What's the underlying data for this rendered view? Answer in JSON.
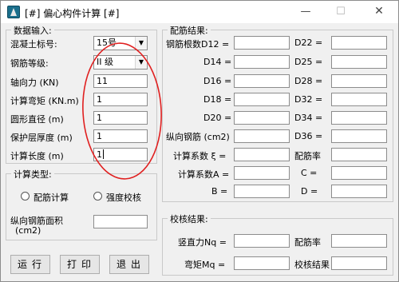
{
  "window": {
    "title": "[#] 偏心构件计算 [#]",
    "minimize": "—",
    "maximize": "☐",
    "close": "✕"
  },
  "input_group": {
    "title": "数据输入:",
    "concrete_label": "混凝土标号:",
    "concrete_value": "15号",
    "rebar_grade_label": "钢筋等级:",
    "rebar_grade_value": "II 级",
    "axial_force_label": "轴向力 (KN)",
    "axial_force_value": "11",
    "moment_label": "计算弯矩 (KN.m)",
    "moment_value": "1",
    "diameter_label": "圆形直径 (m)",
    "diameter_value": "1",
    "cover_label": "保护层厚度 (m)",
    "cover_value": "1",
    "length_label": "计算长度 (m)",
    "length_value": "1"
  },
  "calc_type_group": {
    "title": "计算类型:",
    "option_rebar": "配筋计算",
    "option_strength": "强度校核",
    "steel_area_label_1": "纵向钢筋面积",
    "steel_area_label_2": "(cm2)",
    "steel_area_value": ""
  },
  "buttons": {
    "run": "运行",
    "print": "打印",
    "exit": "退出"
  },
  "result_group": {
    "title": "配筋结果:",
    "bar_count_label": "钢筋根数D12 =",
    "d14": "D14 =",
    "d16": "D16 =",
    "d18": "D18 =",
    "d20": "D20 =",
    "d22": "D22 =",
    "d25": "D25 =",
    "d28": "D28 =",
    "d32": "D32 =",
    "d34": "D34 =",
    "d36": "D36 =",
    "long_rebar_label": "纵向钢筋 (cm2)",
    "xi_label": "计算系数 ξ =",
    "ratio_label": "配筋率",
    "a_label": "计算系数A =",
    "c_label": "C =",
    "b_label": "B =",
    "d_label": "D ="
  },
  "check_group": {
    "title": "校核结果:",
    "nq_label": "竖直力Nq =",
    "ratio_label": "配筋率",
    "mq_label": "弯矩Mq =",
    "result_label": "校核结果"
  },
  "annotation": {
    "color": "#e02020"
  }
}
